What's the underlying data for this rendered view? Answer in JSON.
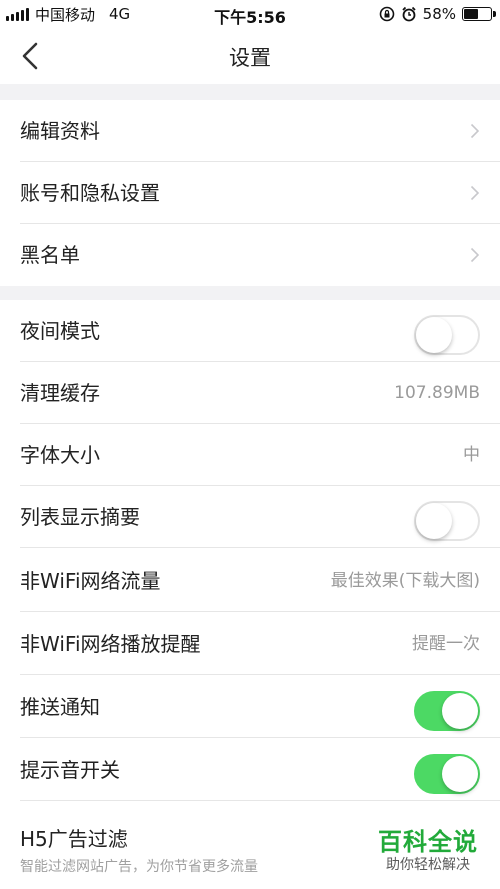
{
  "status_bar": {
    "carrier": "中国移动",
    "network": "4G",
    "time": "下午5:56",
    "battery_percent": "58%",
    "battery_level": 0.58
  },
  "nav": {
    "title": "设置",
    "back_icon": "chevron-left-icon"
  },
  "groups": {
    "account": [
      {
        "label": "编辑资料",
        "icon": "chevron-right-icon"
      },
      {
        "label": "账号和隐私设置",
        "icon": "chevron-right-icon"
      },
      {
        "label": "黑名单",
        "icon": "chevron-right-icon"
      }
    ],
    "prefs": {
      "night_mode": {
        "label": "夜间模式",
        "on": false
      },
      "clear_cache": {
        "label": "清理缓存",
        "value": "107.89MB"
      },
      "font_size": {
        "label": "字体大小",
        "value": "中"
      },
      "list_summary": {
        "label": "列表显示摘要",
        "on": false
      },
      "non_wifi_data": {
        "label": "非WiFi网络流量",
        "value": "最佳效果(下载大图)"
      },
      "non_wifi_play": {
        "label": "非WiFi网络播放提醒",
        "value": "提醒一次"
      },
      "push": {
        "label": "推送通知",
        "on": true
      },
      "sound": {
        "label": "提示音开关",
        "on": true
      },
      "h5_filter": {
        "label": "H5广告过滤",
        "description": "智能过滤网站广告，为你节省更多流量"
      }
    }
  },
  "watermark": {
    "title": "百科全说",
    "subtitle": "助你轻松解决"
  },
  "colors": {
    "toggle_on": "#4cd964",
    "section_gap": "#f2f2f4",
    "watermark": "#22aa3a"
  }
}
